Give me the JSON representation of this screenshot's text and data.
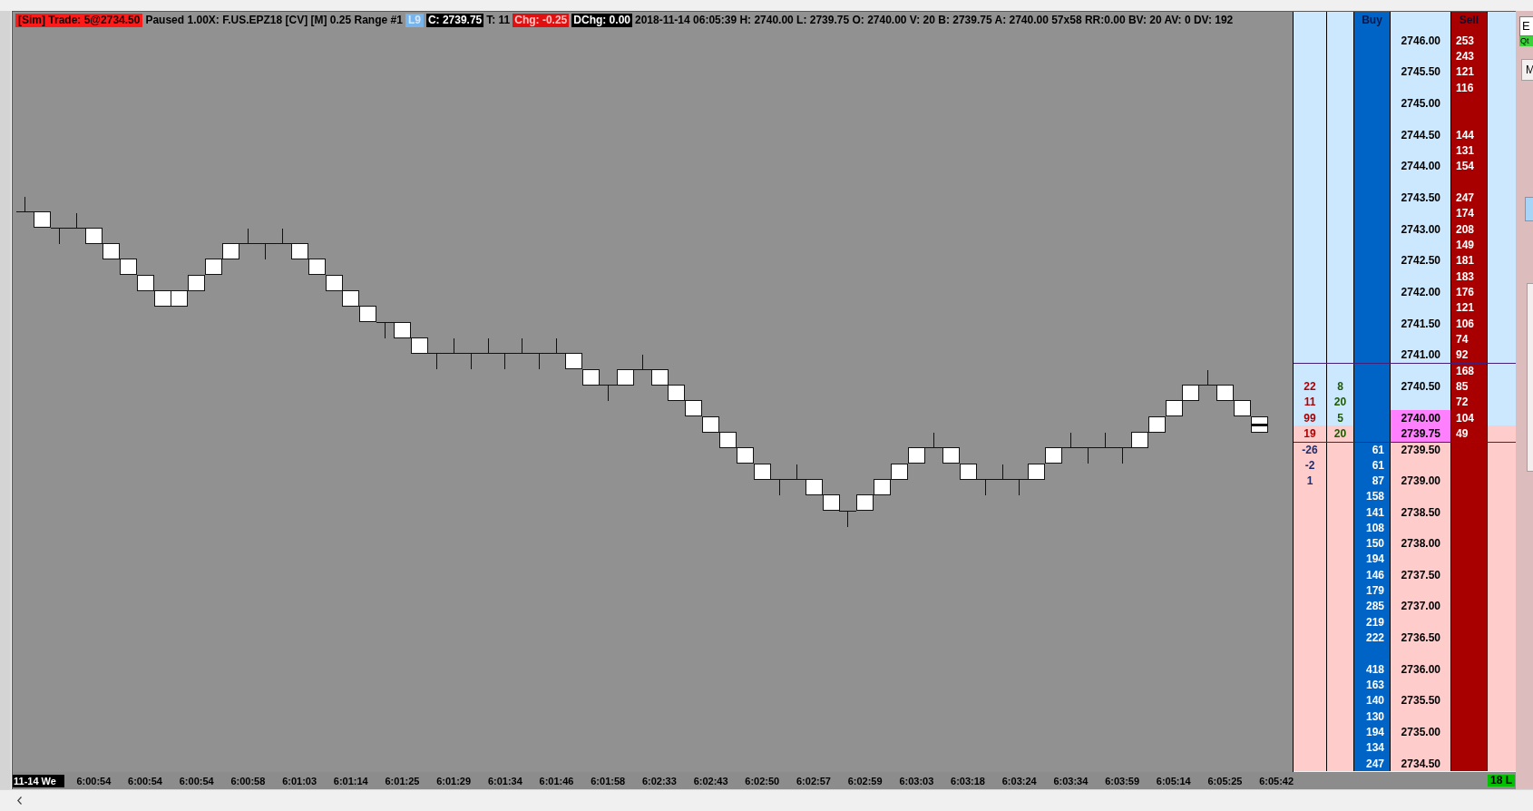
{
  "header_bar": {
    "segments": [
      {
        "text": "[Sim] Trade: 5@2734.50",
        "kind": "alert"
      },
      {
        "text": "Paused 1.00X: F.US.EPZ18 [CV] [M] 0.25 Range #1",
        "kind": "plain"
      },
      {
        "text": "L9",
        "kind": "info"
      },
      {
        "text": "C: 2739.75",
        "kind": "inverse"
      },
      {
        "text": "T: 11",
        "kind": "plain"
      },
      {
        "text": "Chg: -0.25",
        "kind": "negative"
      },
      {
        "text": "DChg: 0.00",
        "kind": "inverse"
      },
      {
        "text": "2018-11-14 06:05:39 H: 2740.00 L: 2739.75 O: 2740.00 V: 20 B: 2739.75 A: 2740.00 57x58 RR:0.00 BV: 20 AV: 0 DV: 192",
        "kind": "plain"
      }
    ]
  },
  "time_axis": {
    "date_label": "11-14 We",
    "labels": [
      "6:00:54",
      "6:00:54",
      "6:00:54",
      "6:00:58",
      "6:01:03",
      "6:01:14",
      "6:01:25",
      "6:01:29",
      "6:01:34",
      "6:01:46",
      "6:01:58",
      "6:02:33",
      "6:02:43",
      "6:02:50",
      "6:02:57",
      "6:02:59",
      "6:03:03",
      "6:03:18",
      "6:03:24",
      "6:03:34",
      "6:03:59",
      "6:05:14",
      "6:05:25",
      "6:05:42"
    ],
    "position_badge": "18 L"
  },
  "dom": {
    "buy_header": "Buy",
    "sell_header": "Sell",
    "rows": [
      {
        "price": "2746.00",
        "sell": "253",
        "kind": "ask",
        "highlighted": false,
        "line_above": false
      },
      {
        "sell": "243",
        "kind": "ask",
        "highlighted": false,
        "line_above": false
      },
      {
        "price": "2745.50",
        "sell": "121",
        "kind": "ask",
        "highlighted": false,
        "line_above": false
      },
      {
        "sell": "116",
        "kind": "ask",
        "highlighted": false,
        "line_above": false
      },
      {
        "price": "2745.00",
        "kind": "ask",
        "highlighted": false,
        "line_above": false
      },
      {
        "kind": "ask",
        "highlighted": false,
        "line_above": false
      },
      {
        "price": "2744.50",
        "sell": "144",
        "kind": "ask",
        "highlighted": false,
        "line_above": false
      },
      {
        "sell": "131",
        "kind": "ask",
        "highlighted": false,
        "line_above": false
      },
      {
        "price": "2744.00",
        "sell": "154",
        "kind": "ask",
        "highlighted": false,
        "line_above": false
      },
      {
        "kind": "ask",
        "highlighted": false,
        "line_above": false
      },
      {
        "price": "2743.50",
        "sell": "247",
        "kind": "ask",
        "highlighted": false,
        "line_above": false
      },
      {
        "sell": "174",
        "kind": "ask",
        "highlighted": false,
        "line_above": false
      },
      {
        "price": "2743.00",
        "sell": "208",
        "kind": "ask",
        "highlighted": false,
        "line_above": false
      },
      {
        "sell": "149",
        "kind": "ask",
        "highlighted": false,
        "line_above": false
      },
      {
        "price": "2742.50",
        "sell": "181",
        "kind": "ask",
        "highlighted": false,
        "line_above": false
      },
      {
        "sell": "183",
        "kind": "ask",
        "highlighted": false,
        "line_above": false
      },
      {
        "price": "2742.00",
        "sell": "176",
        "kind": "ask",
        "highlighted": false,
        "line_above": false
      },
      {
        "sell": "121",
        "kind": "ask",
        "highlighted": false,
        "line_above": false
      },
      {
        "price": "2741.50",
        "sell": "106",
        "kind": "ask",
        "highlighted": false,
        "line_above": false
      },
      {
        "sell": "74",
        "kind": "ask",
        "highlighted": false,
        "line_above": false
      },
      {
        "price": "2741.00",
        "sell": "92",
        "kind": "ask",
        "highlighted": false,
        "line_above": false
      },
      {
        "sell": "168",
        "kind": "ask",
        "highlighted": false,
        "line_above": true
      },
      {
        "price": "2740.50",
        "column_1": {
          "text": "22",
          "color": "#b00000"
        },
        "column_2": "8",
        "sell": "85",
        "kind": "ask",
        "highlighted": false,
        "line_above": false
      },
      {
        "column_1": {
          "text": "11",
          "color": "#b00000"
        },
        "column_2": "20",
        "sell": "72",
        "kind": "ask",
        "highlighted": false,
        "line_above": false
      },
      {
        "price": "2740.00",
        "column_1": {
          "text": "99",
          "color": "#b00000"
        },
        "column_2": "5",
        "sell": "104",
        "kind": "ask",
        "highlighted": true,
        "line_above": false
      },
      {
        "price": "2739.75",
        "column_1": {
          "text": "19",
          "color": "#b00000"
        },
        "column_2": "20",
        "sell": "49",
        "kind": "bid",
        "highlighted": true,
        "line_above": false
      },
      {
        "price": "2739.50",
        "column_1": {
          "text": "-26",
          "color": "#1f2d6b"
        },
        "buy": "61",
        "kind": "bid",
        "highlighted": false,
        "line_above": true
      },
      {
        "column_1": {
          "text": "-2",
          "color": "#1f2d6b"
        },
        "buy": "61",
        "kind": "bid",
        "highlighted": false,
        "line_above": false
      },
      {
        "price": "2739.00",
        "column_1": {
          "text": "1",
          "color": "#1f2d6b"
        },
        "buy": "87",
        "kind": "bid",
        "highlighted": false,
        "line_above": false
      },
      {
        "buy": "158",
        "kind": "bid",
        "highlighted": false,
        "line_above": false
      },
      {
        "price": "2738.50",
        "buy": "141",
        "kind": "bid",
        "highlighted": false,
        "line_above": false
      },
      {
        "buy": "108",
        "kind": "bid",
        "highlighted": false,
        "line_above": false
      },
      {
        "price": "2738.00",
        "buy": "150",
        "kind": "bid",
        "highlighted": false,
        "line_above": false
      },
      {
        "buy": "194",
        "kind": "bid",
        "highlighted": false,
        "line_above": false
      },
      {
        "price": "2737.50",
        "buy": "146",
        "kind": "bid",
        "highlighted": false,
        "line_above": false
      },
      {
        "buy": "179",
        "kind": "bid",
        "highlighted": false,
        "line_above": false
      },
      {
        "price": "2737.00",
        "buy": "285",
        "kind": "bid",
        "highlighted": false,
        "line_above": false
      },
      {
        "buy": "219",
        "kind": "bid",
        "highlighted": false,
        "line_above": false
      },
      {
        "price": "2736.50",
        "buy": "222",
        "kind": "bid",
        "highlighted": false,
        "line_above": false
      },
      {
        "kind": "bid",
        "highlighted": false,
        "line_above": false
      },
      {
        "price": "2736.00",
        "buy": "418",
        "kind": "bid",
        "highlighted": false,
        "line_above": false
      },
      {
        "buy": "163",
        "kind": "bid",
        "highlighted": false,
        "line_above": false
      },
      {
        "price": "2735.50",
        "buy": "140",
        "kind": "bid",
        "highlighted": false,
        "line_above": false
      },
      {
        "buy": "130",
        "kind": "bid",
        "highlighted": false,
        "line_above": false
      },
      {
        "price": "2735.00",
        "buy": "194",
        "kind": "bid",
        "highlighted": false,
        "line_above": false
      },
      {
        "buy": "134",
        "kind": "bid",
        "highlighted": false,
        "line_above": false
      },
      {
        "price": "2734.50",
        "buy": "247",
        "kind": "bid",
        "highlighted": false,
        "line_above": false
      }
    ]
  },
  "side_panel": {
    "symbol_field": {
      "value": "E"
    },
    "quantity_label": "Qt",
    "tab": "M"
  }
}
